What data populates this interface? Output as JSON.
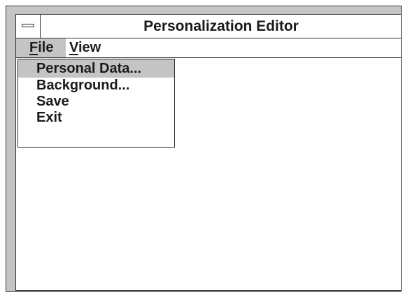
{
  "window": {
    "title": "Personalization Editor",
    "system_menu_icon": "system-menu-icon"
  },
  "menubar": {
    "items": [
      {
        "mnemonic": "F",
        "rest": "ile",
        "label": "File",
        "state": "open"
      },
      {
        "mnemonic": "V",
        "rest": "iew",
        "label": "View",
        "state": "closed"
      }
    ]
  },
  "file_menu": {
    "items": [
      {
        "label": "Personal Data...",
        "highlighted": true
      },
      {
        "label": "Background...",
        "highlighted": false
      },
      {
        "label": "Save",
        "highlighted": false
      },
      {
        "label": "Exit",
        "highlighted": false
      }
    ]
  },
  "colors": {
    "frame": "#c4c4c4",
    "highlight": "#c4c4c4",
    "border": "#333333",
    "text": "#1a1a1a"
  }
}
